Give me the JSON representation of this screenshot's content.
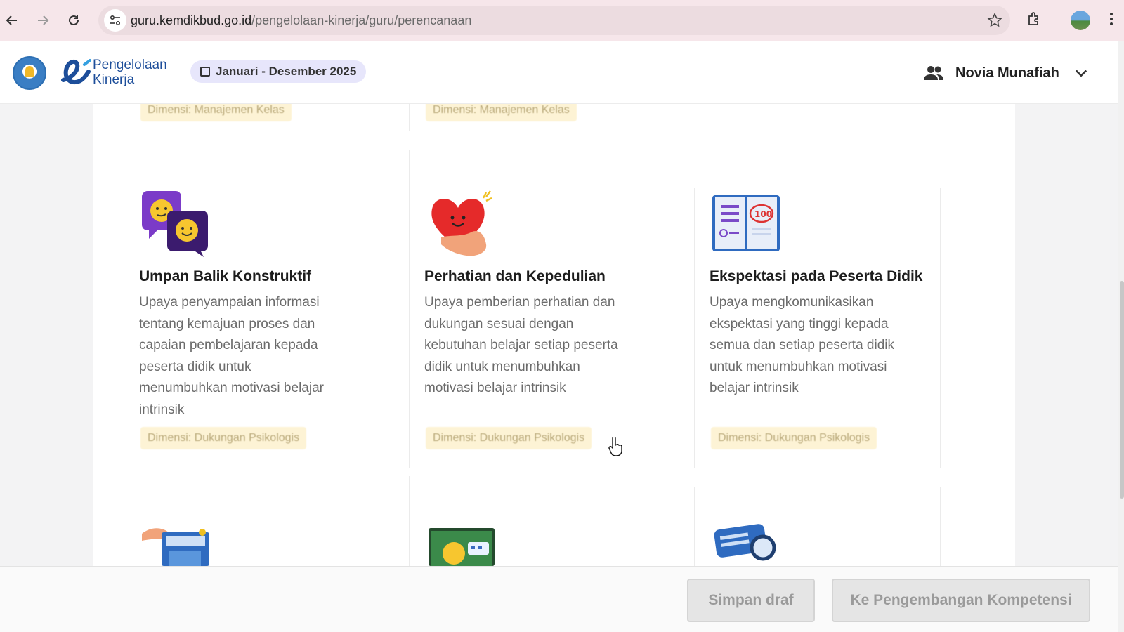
{
  "browser": {
    "url_host": "guru.kemdikbud.go.id",
    "url_path": "/pengelolaan-kinerja/guru/perencanaan"
  },
  "header": {
    "brand_line1": "Pengelolaan",
    "brand_line2": "Kinerja",
    "period": "Januari - Desember 2025",
    "user_name": "Novia Munafiah"
  },
  "cards_top_row": [
    {
      "badge": "Dimensi: Manajemen Kelas"
    },
    {
      "badge": "Dimensi: Manajemen Kelas"
    }
  ],
  "cards": [
    {
      "icon": "speech-bubbles-faces-icon",
      "title": "Umpan Balik Konstruktif",
      "desc_lines": [
        "Upaya penyampaian informasi",
        "tentang kemajuan proses dan",
        "capaian pembelajaran kepada",
        "peserta didik untuk",
        "menumbuhkan motivasi belajar",
        "intrinsik"
      ],
      "badge": "Dimensi: Dukungan Psikologis"
    },
    {
      "icon": "heart-hand-icon",
      "title": "Perhatian dan Kepedulian",
      "desc_lines": [
        "Upaya pemberian perhatian dan",
        "dukungan sesuai dengan",
        "kebutuhan belajar setiap peserta",
        "didik untuk menumbuhkan",
        "motivasi belajar intrinsik"
      ],
      "badge": "Dimensi: Dukungan Psikologis"
    },
    {
      "icon": "book-score-icon",
      "title": "Ekspektasi pada Peserta Didik",
      "desc_lines": [
        "Upaya mengkomunikasikan",
        "ekspektasi yang tinggi kepada",
        "semua dan setiap peserta didik",
        "untuk menumbuhkan motivasi",
        "belajar intrinsik"
      ],
      "badge": "Dimensi: Dukungan Psikologis"
    }
  ],
  "footer": {
    "draft_label": "Simpan draf",
    "next_label": "Ke Pengembangan Kompetensi"
  },
  "colors": {
    "brand_blue": "#1d4e9a",
    "badge_bg": "#fdf3d5",
    "period_bg": "#e7e6fb"
  }
}
